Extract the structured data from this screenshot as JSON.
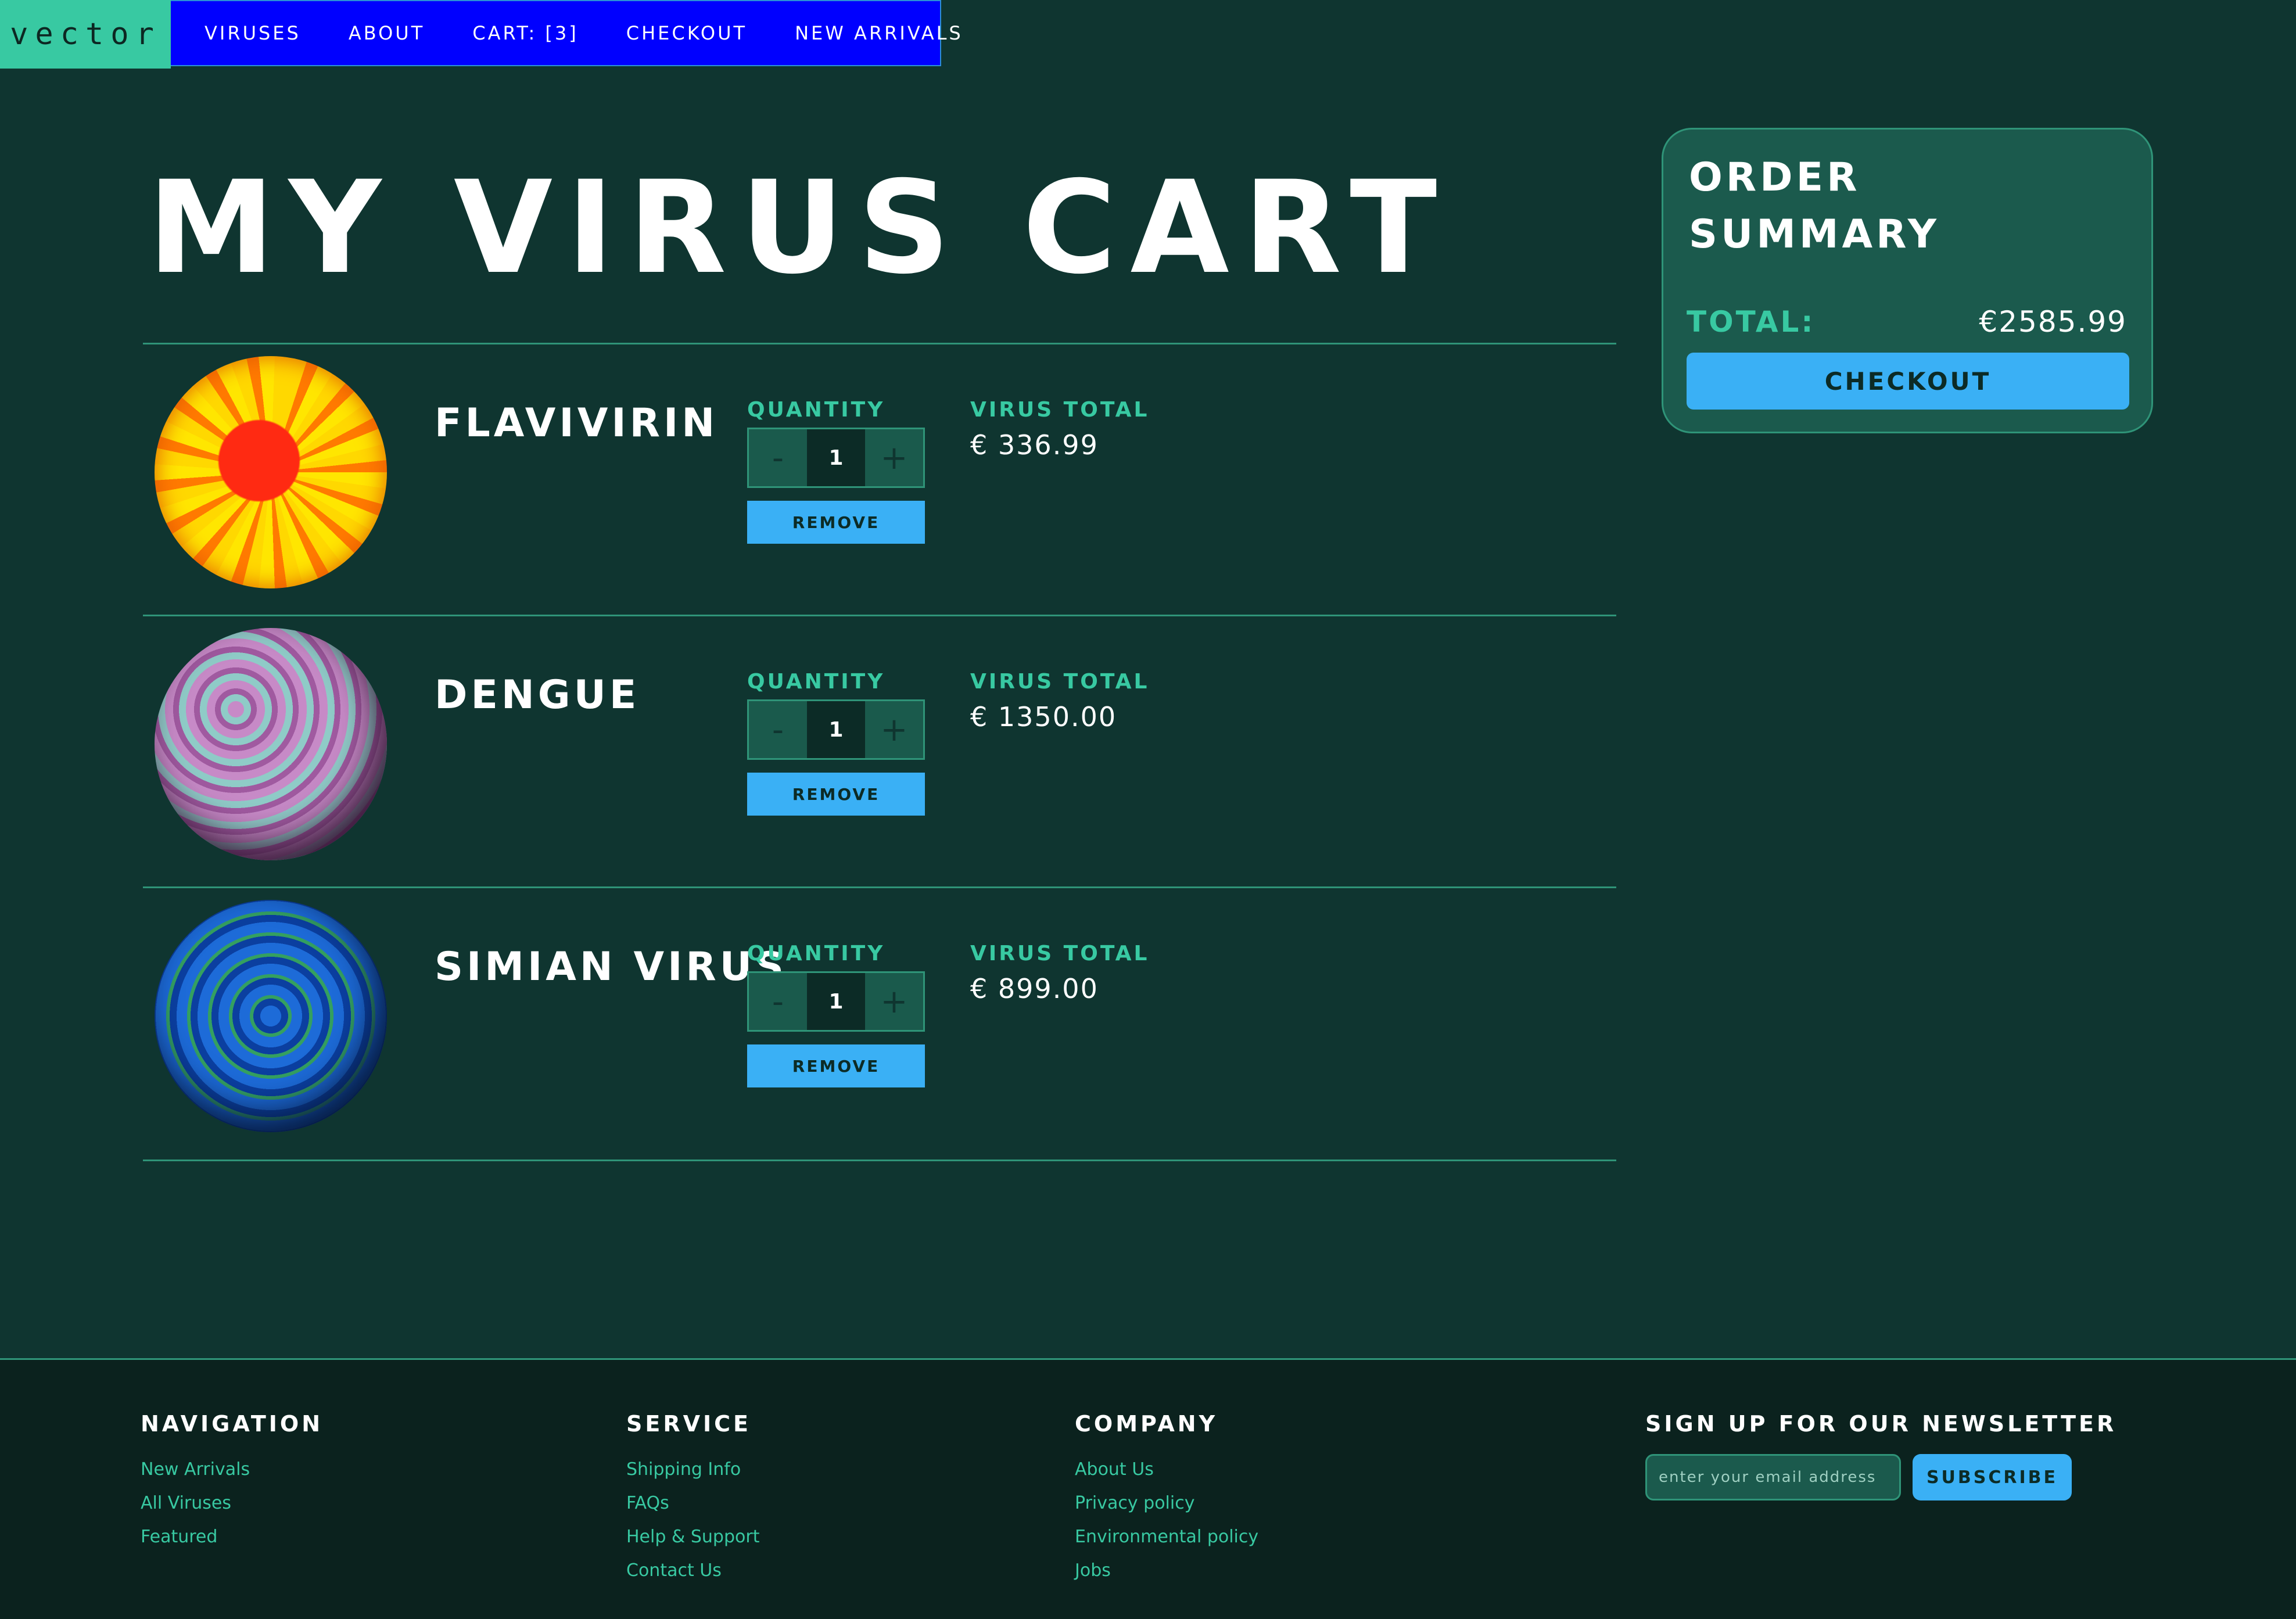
{
  "nav": {
    "logo": "vector",
    "links": [
      "VIRUSES",
      "ABOUT",
      "CART: [3]",
      "CHECKOUT",
      "NEW ARRIVALS"
    ]
  },
  "page": {
    "title": "MY VIRUS CART"
  },
  "cart": {
    "quantity_label": "QUANTITY",
    "virus_total_label": "VIRUS TOTAL",
    "remove_label": "REMOVE",
    "minus": "-",
    "plus": "+",
    "items": [
      {
        "name": "FLAVIVIRIN",
        "quantity": "1",
        "total": "€ 336.99"
      },
      {
        "name": "DENGUE",
        "quantity": "1",
        "total": "€ 1350.00"
      },
      {
        "name": "SIMIAN VIRUS",
        "quantity": "1",
        "total": "€ 899.00"
      }
    ]
  },
  "summary": {
    "title": "ORDER SUMMARY",
    "total_label": "TOTAL:",
    "total_value": "€2585.99",
    "checkout_label": "CHECKOUT"
  },
  "footer": {
    "navigation": {
      "heading": "NAVIGATION",
      "links": [
        "New Arrivals",
        "All Viruses",
        "Featured"
      ]
    },
    "service": {
      "heading": "SERVICE",
      "links": [
        "Shipping Info",
        "FAQs",
        "Help & Support",
        "Contact Us"
      ]
    },
    "company": {
      "heading": "COMPANY",
      "links": [
        "About Us",
        "Privacy policy",
        "Environmental policy",
        "Jobs"
      ]
    },
    "newsletter": {
      "heading": "SIGN UP FOR OUR NEWSLETTER",
      "placeholder": "enter your email address",
      "subscribe_label": "SUBSCRIBE"
    }
  },
  "colors": {
    "background": "#0f3530",
    "accent": "#38c9a2",
    "nav_blue": "#0000ff",
    "button_blue": "#3ab0f5",
    "footer_bg": "#0b221e"
  }
}
